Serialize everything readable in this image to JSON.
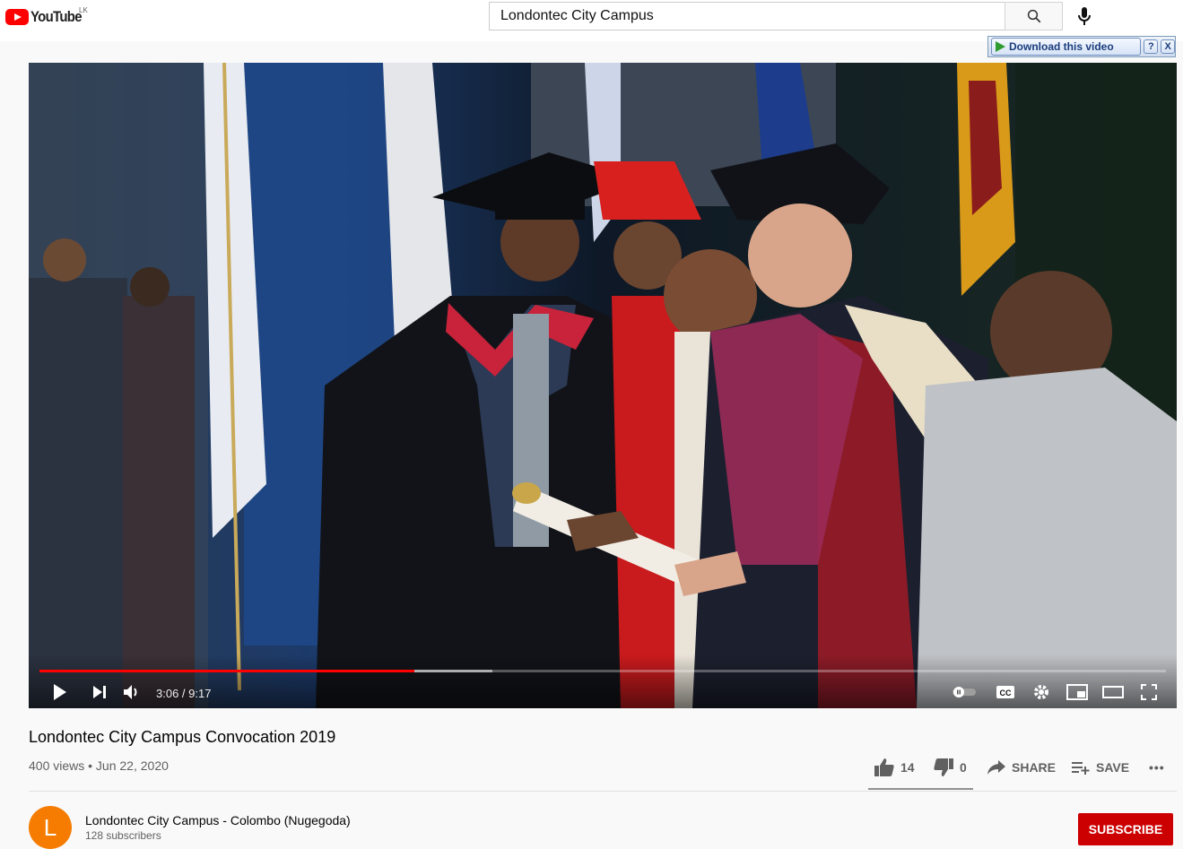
{
  "header": {
    "logo_text": "YouTube",
    "logo_region": "LK",
    "search_value": "Londontec City Campus",
    "search_icon": "search-icon",
    "mic_icon": "mic-icon"
  },
  "download_bar": {
    "label": "Download this video",
    "help": "?",
    "close": "X"
  },
  "player": {
    "time": "3:06 / 9:17",
    "progress_played_fraction": 0.333,
    "progress_loaded_fraction": 0.402,
    "icons": [
      "play-icon",
      "next-icon",
      "volume-icon",
      "autoplay-toggle-icon",
      "cc-icon",
      "settings-icon",
      "miniplayer-icon",
      "theater-icon",
      "fullscreen-icon"
    ],
    "cc_label": "CC"
  },
  "video": {
    "title": "Londontec City Campus Convocation 2019",
    "meta": "400 views • Jun 22, 2020"
  },
  "actions": {
    "likes": "14",
    "dislikes": "0",
    "share": "SHARE",
    "save": "SAVE",
    "more": "•••"
  },
  "channel": {
    "avatar_letter": "L",
    "name": "Londontec City Campus - Colombo (Nugegoda)",
    "subscribers": "128 subscribers",
    "subscribe_label": "SUBSCRIBE"
  },
  "colors": {
    "brand_red": "#ff0000",
    "subscribe_red": "#cc0000",
    "avatar_orange": "#f57c00"
  }
}
